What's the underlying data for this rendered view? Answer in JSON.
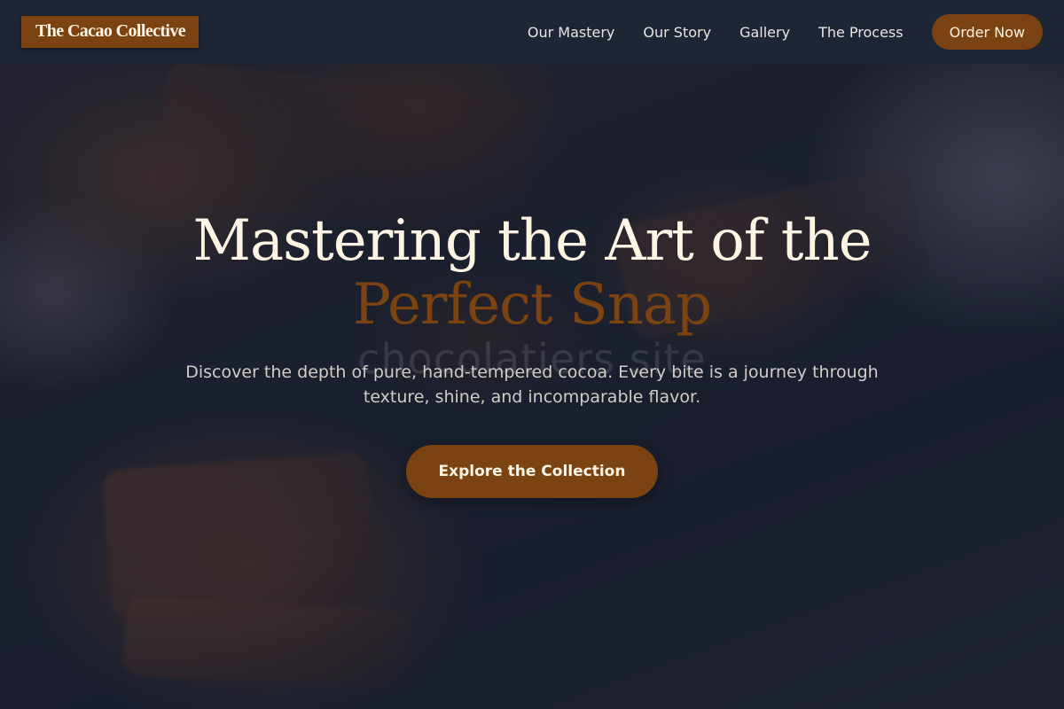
{
  "brand": {
    "logo_text": "The Cacao Collective"
  },
  "nav": {
    "links": [
      {
        "label": "Our Mastery"
      },
      {
        "label": "Our Story"
      },
      {
        "label": "Gallery"
      },
      {
        "label": "The Process"
      }
    ],
    "cta_label": "Order Now"
  },
  "hero": {
    "headline_line1": "Mastering the Art of the",
    "headline_line2": "Perfect Snap",
    "ghost_text": "chocolatiers site",
    "subtext": "Discover the depth of pure, hand-tempered cocoa. Every bite is a journey through texture, shine, and incomparable flavor.",
    "button_label": "Explore the Collection"
  },
  "colors": {
    "accent": "#7a4311",
    "headline": "#fdf4e3",
    "navbar": "#1e2636"
  }
}
